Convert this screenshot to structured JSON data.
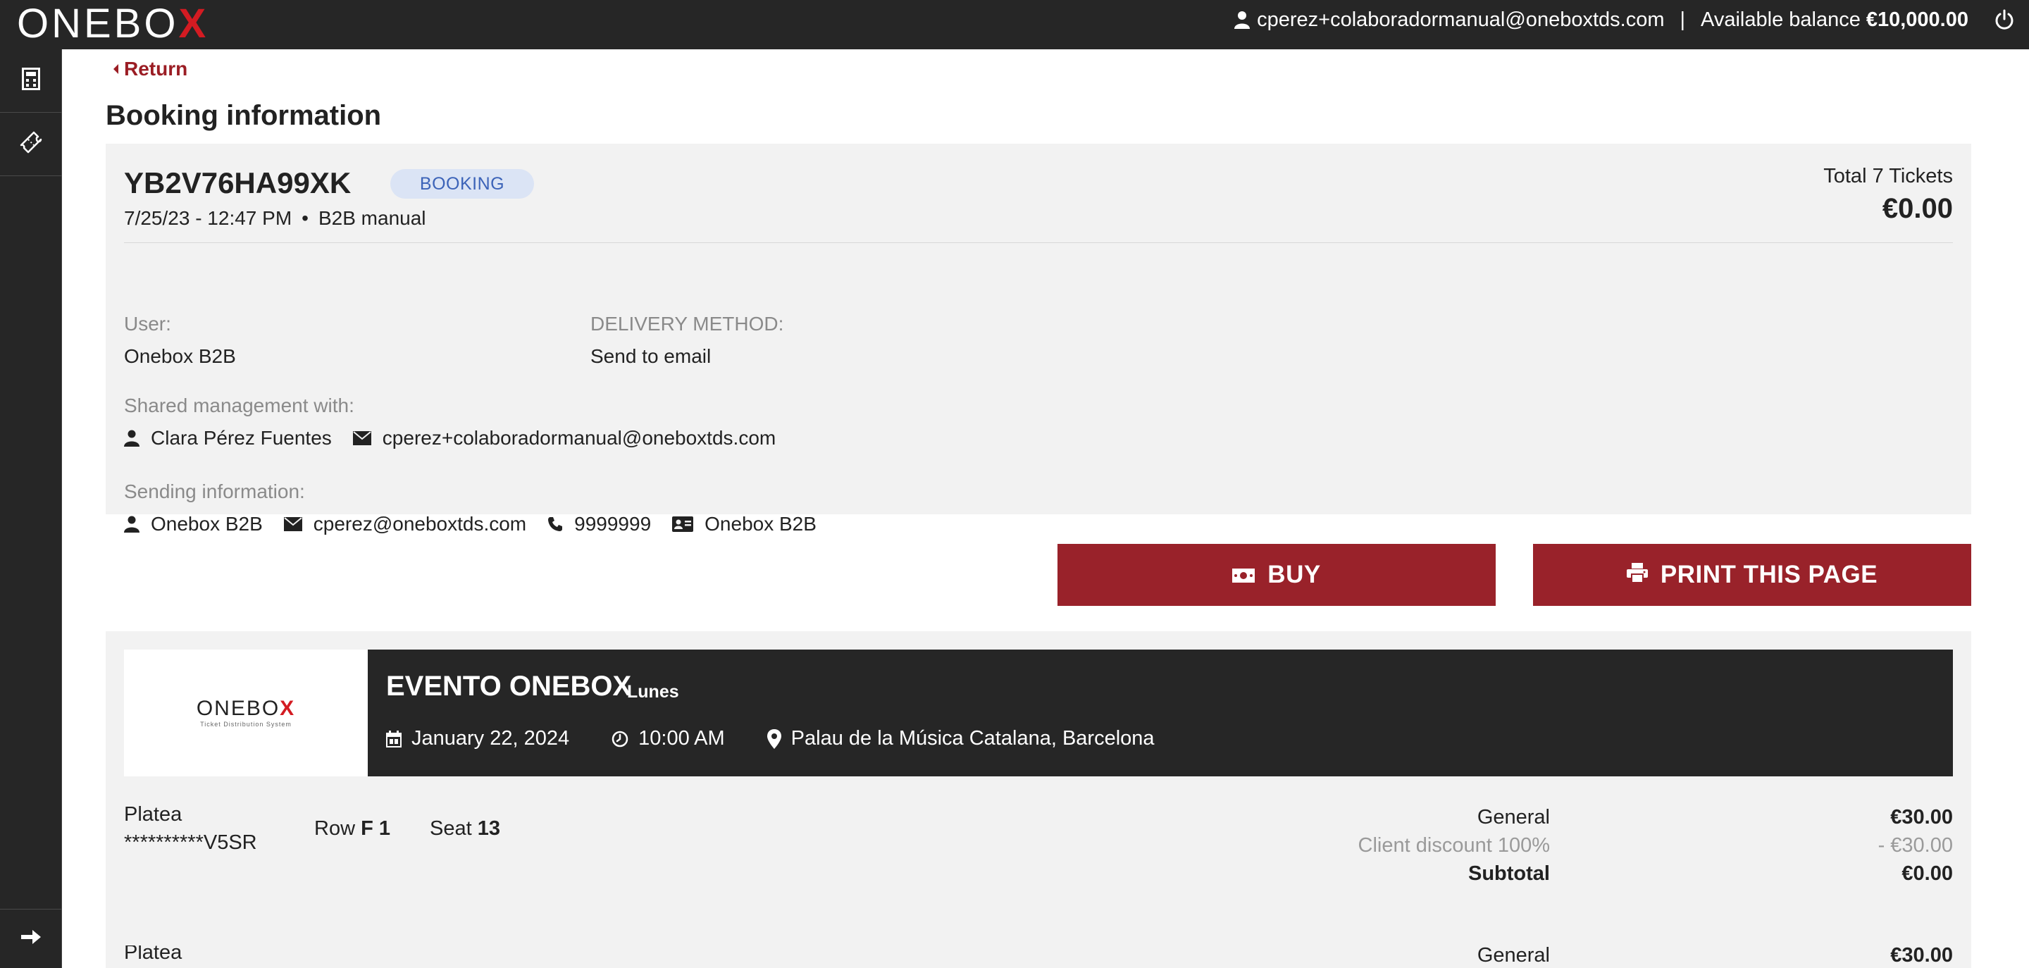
{
  "header": {
    "logo_text": "ONEBO",
    "logo_x": "X",
    "user_email": "cperez+colaboradormanual@oneboxtds.com",
    "separator": "|",
    "balance_label": "Available balance",
    "balance_amount": "€10,000.00",
    "icons": [
      "user-icon",
      "power-icon"
    ]
  },
  "sidebar": {
    "items": [
      {
        "name": "calculator-icon"
      },
      {
        "name": "ticket-icon"
      }
    ],
    "bottom": {
      "name": "arrow-right-icon"
    }
  },
  "nav": {
    "return_label": "Return"
  },
  "page": {
    "title": "Booking information"
  },
  "booking": {
    "code": "YB2V76HA99XK",
    "badge": "BOOKING",
    "datetime": "7/25/23 - 12:47 PM",
    "dot": "•",
    "channel": "B2B manual",
    "total_label": "Total 7 Tickets",
    "total_amount": "€0.00",
    "user_label": "User:",
    "user_value": "Onebox B2B",
    "delivery_label": "DELIVERY METHOD:",
    "delivery_value": "Send to email",
    "shared_label": "Shared management with:",
    "shared_name": "Clara Pérez Fuentes",
    "shared_email": "cperez+colaboradormanual@oneboxtds.com",
    "sending_label": "Sending information:",
    "sending_name": "Onebox B2B",
    "sending_email": "cperez@oneboxtds.com",
    "sending_phone": "9999999",
    "sending_id": "Onebox B2B"
  },
  "actions": {
    "buy_label": "BUY",
    "print_label": "PRINT THIS PAGE"
  },
  "event": {
    "logo_text": "ONEBO",
    "logo_x": "X",
    "logo_sub": "Ticket Distribution System",
    "name": "EVENTO ONEBOX",
    "day": "Lunes",
    "date": "January 22, 2024",
    "time": "10:00 AM",
    "venue": "Palau de la Música Catalana, Barcelona"
  },
  "tickets": [
    {
      "zone": "Platea",
      "code": "**********V5SR",
      "row_label": "Row",
      "row_value": "F 1",
      "seat_label": "Seat",
      "seat_value": "13",
      "line1_label": "General",
      "line1_value": "€30.00",
      "line2_label": "Client discount 100%",
      "line2_value": "- €30.00",
      "line3_label": "Subtotal",
      "line3_value": "€0.00"
    },
    {
      "zone": "Platea",
      "line1_label": "General",
      "line1_value": "€30.00"
    }
  ],
  "colors": {
    "dark": "#262626",
    "accent_red": "#99222a",
    "logo_red": "#d31b22",
    "card_bg": "#f2f2f2",
    "badge_bg": "#dbe4f5",
    "badge_text": "#3c63b8"
  }
}
